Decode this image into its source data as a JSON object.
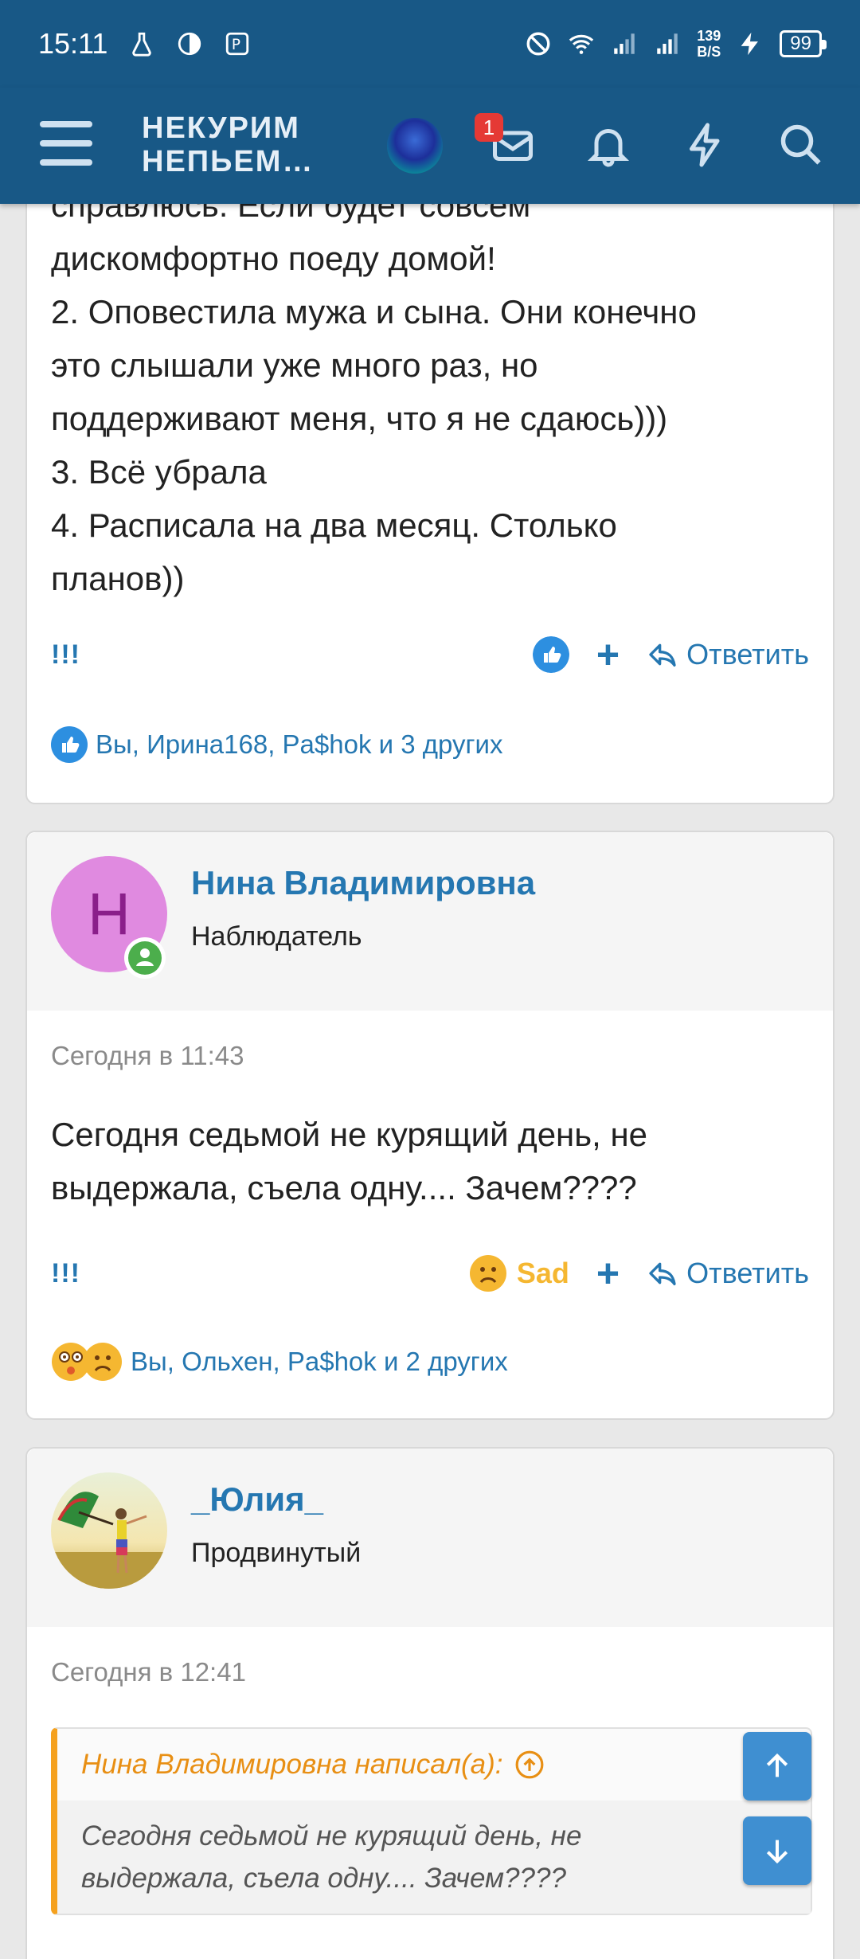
{
  "status_bar": {
    "time": "15:11",
    "net_speed_value": "139",
    "net_speed_unit": "B/S",
    "battery": "99"
  },
  "header": {
    "brand_line1": "НЕКУРИМ",
    "brand_line2": "НЕПЬЕМ…",
    "messages_badge": "1"
  },
  "post1": {
    "body_lines": [
      "справлюсь. Если будет совсем",
      "дискомфортно поеду домой!",
      "2. Оповестила мужа и сына. Они конечно",
      "это слышали уже много раз, но",
      "поддерживают меня, что я не сдаюсь)))",
      "3. Всё убрала",
      "4. Расписала на два месяц. Столько",
      "планов))"
    ],
    "report_label": "!!!",
    "plus_label": "+",
    "reply_label": "Ответить",
    "reactions_text": "Вы, Ирина168, Pa$hok и 3 других"
  },
  "post2": {
    "author_initial": "Н",
    "author_name": "Нина Владимировна",
    "author_title": "Наблюдатель",
    "date": "Сегодня в 11:43",
    "body_lines": [
      "Сегодня седьмой не курящий день, не",
      "выдержала, съела одну.... Зачем????"
    ],
    "report_label": "!!!",
    "reaction_label": "Sad",
    "plus_label": "+",
    "reply_label": "Ответить",
    "reactions_text": "Вы, Ольхен, Pa$hok и 2 других"
  },
  "post3": {
    "author_name": "_Юлия_",
    "author_title": "Продвинутый",
    "date": "Сегодня в 12:41",
    "quote_header": "Нина Владимировна написал(а):",
    "quote_lines": [
      "Сегодня седьмой не курящий день, не",
      "выдержала, съела одну.... Зачем????"
    ]
  },
  "colors": {
    "header_bg": "#185886",
    "link": "#2577b1",
    "quote_accent": "#f5a11e",
    "sad": "#f5b731",
    "badge": "#e53935",
    "scroll_button": "#3f8fd1"
  }
}
